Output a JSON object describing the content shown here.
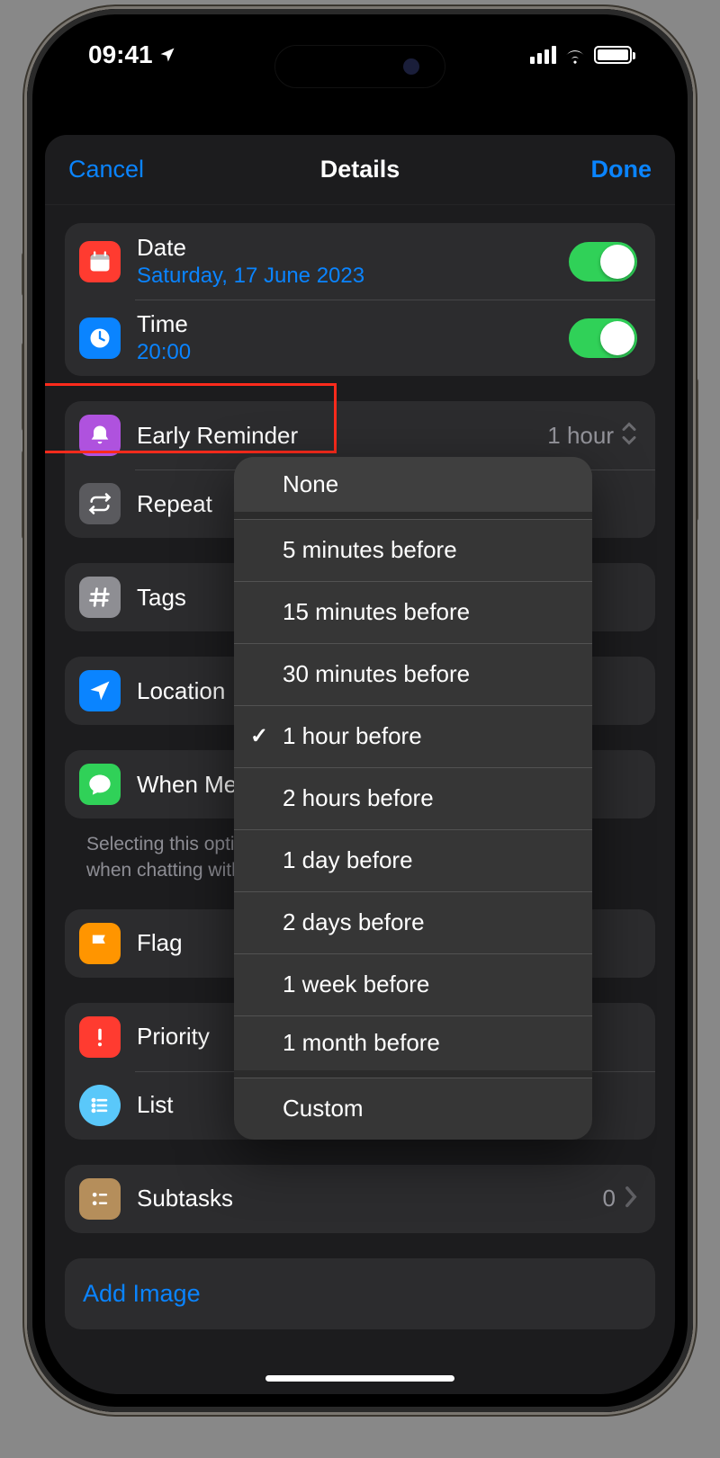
{
  "status": {
    "time": "09:41"
  },
  "nav": {
    "cancel": "Cancel",
    "title": "Details",
    "done": "Done"
  },
  "rows": {
    "date": {
      "label": "Date",
      "sub": "Saturday, 17 June 2023",
      "on": true,
      "icon_color": "#ff3b30"
    },
    "time": {
      "label": "Time",
      "sub": "20:00",
      "on": true,
      "icon_color": "#0a84ff"
    },
    "early": {
      "label": "Early Reminder",
      "value": "1 hour",
      "icon_color": "#af52de"
    },
    "repeat": {
      "label": "Repeat",
      "icon_color": "#5a5a5e"
    },
    "tags": {
      "label": "Tags",
      "icon_color": "#8e8e93"
    },
    "location": {
      "label": "Location",
      "icon_color": "#0a84ff"
    },
    "messaging": {
      "label": "When Me",
      "icon_color": "#30d158"
    },
    "flag": {
      "label": "Flag",
      "icon_color": "#ff9500"
    },
    "priority": {
      "label": "Priority",
      "icon_color": "#ff3b30"
    },
    "list": {
      "label": "List",
      "icon_color": "#5ac8fa"
    },
    "subtasks": {
      "label": "Subtasks",
      "value": "0",
      "icon_color": "#b58e5b"
    }
  },
  "hint": "Selecting this optio\nwhen chatting with",
  "add_image": "Add Image",
  "popover": {
    "options": [
      {
        "label": "None",
        "selected": false,
        "sep_after": true
      },
      {
        "label": "5 minutes before",
        "selected": false
      },
      {
        "label": "15 minutes before",
        "selected": false
      },
      {
        "label": "30 minutes before",
        "selected": false
      },
      {
        "label": "1 hour before",
        "selected": true
      },
      {
        "label": "2 hours before",
        "selected": false
      },
      {
        "label": "1 day before",
        "selected": false
      },
      {
        "label": "2 days before",
        "selected": false
      },
      {
        "label": "1 week before",
        "selected": false
      },
      {
        "label": "1 month before",
        "selected": false,
        "sep_after": true
      },
      {
        "label": "Custom",
        "selected": false
      }
    ]
  }
}
